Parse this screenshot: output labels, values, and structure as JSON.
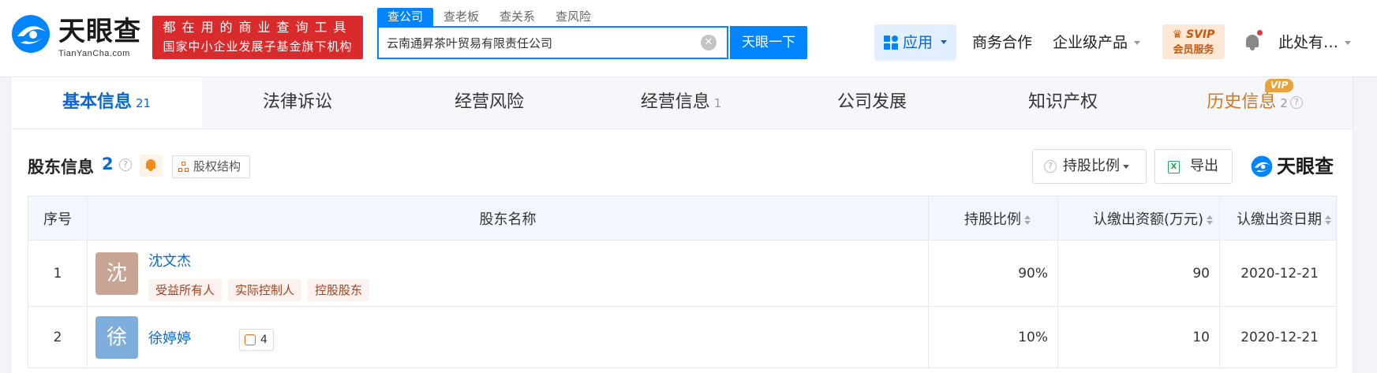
{
  "header": {
    "logo_text": "天眼查",
    "logo_sub": "TianYanCha.com",
    "slogan_line1": "都在用的商业查询工具",
    "slogan_line2": "国家中小企业发展子基金旗下机构",
    "search_tabs": [
      "查公司",
      "查老板",
      "查关系",
      "查风险"
    ],
    "search_value": "云南通昇茶叶贸易有限责任公司",
    "search_button": "天眼一下",
    "app_label": "应用",
    "nav_business": "商务合作",
    "nav_enterprise": "企业级产品",
    "svip_line1": "SVIP",
    "svip_line2": "会员服务",
    "user_name": "此处有…"
  },
  "tabs": [
    {
      "label": "基本信息",
      "count": "21"
    },
    {
      "label": "法律诉讼",
      "count": ""
    },
    {
      "label": "经营风险",
      "count": ""
    },
    {
      "label": "经营信息",
      "count": "1"
    },
    {
      "label": "公司发展",
      "count": ""
    },
    {
      "label": "知识产权",
      "count": ""
    },
    {
      "label": "历史信息",
      "count": "2"
    }
  ],
  "history_vip_tag": "VIP",
  "section": {
    "title": "股东信息",
    "count": "2",
    "equity_button": "股权结构",
    "ratio_button": "持股比例",
    "export_button": "导出",
    "brand_text": "天眼查"
  },
  "table": {
    "headers": [
      "序号",
      "股东名称",
      "持股比例",
      "认缴出资额(万元)",
      "认缴出资日期"
    ],
    "rows": [
      {
        "index": "1",
        "avatar_char": "沈",
        "avatar_color": "#c9a596",
        "name": "沈文杰",
        "tags": [
          "受益所有人",
          "实际控制人",
          "控股股东"
        ],
        "ratio": "90%",
        "amount": "90",
        "date": "2020-12-21"
      },
      {
        "index": "2",
        "avatar_char": "徐",
        "avatar_color": "#7eaedb",
        "name": "徐婷婷",
        "relation_count": "4",
        "ratio": "10%",
        "amount": "10",
        "date": "2020-12-21"
      }
    ]
  },
  "colors": {
    "brand_blue": "#0084ff",
    "link_blue": "#0a67d0",
    "slogan_red": "#d92b2b"
  }
}
